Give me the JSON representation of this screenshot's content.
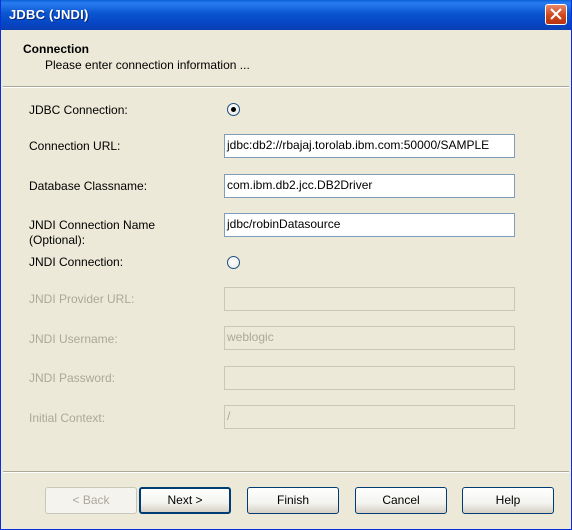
{
  "window": {
    "title": "JDBC (JNDI)"
  },
  "header": {
    "title": "Connection",
    "subtitle": "Please enter connection information ..."
  },
  "form": {
    "jdbc_connection_label": "JDBC Connection:",
    "jdbc_connection_selected": true,
    "connection_url_label": "Connection URL:",
    "connection_url_value": "jdbc:db2://rbajaj.torolab.ibm.com:50000/SAMPLE",
    "db_classname_label": "Database Classname:",
    "db_classname_value": "com.ibm.db2.jcc.DB2Driver",
    "jndi_name_label_line1": "JNDI Connection Name",
    "jndi_name_label_line2": "(Optional):",
    "jndi_name_value": "jdbc/robinDatasource",
    "jndi_connection_label": "JNDI Connection:",
    "jndi_connection_selected": false,
    "jndi_provider_url_label": "JNDI Provider URL:",
    "jndi_provider_url_value": "",
    "jndi_username_label": "JNDI Username:",
    "jndi_username_value": "weblogic",
    "jndi_password_label": "JNDI Password:",
    "jndi_password_value": "",
    "initial_context_label": "Initial Context:",
    "initial_context_value": "/"
  },
  "buttons": {
    "back": "< Back",
    "next": "Next >",
    "finish": "Finish",
    "cancel": "Cancel",
    "help": "Help"
  }
}
